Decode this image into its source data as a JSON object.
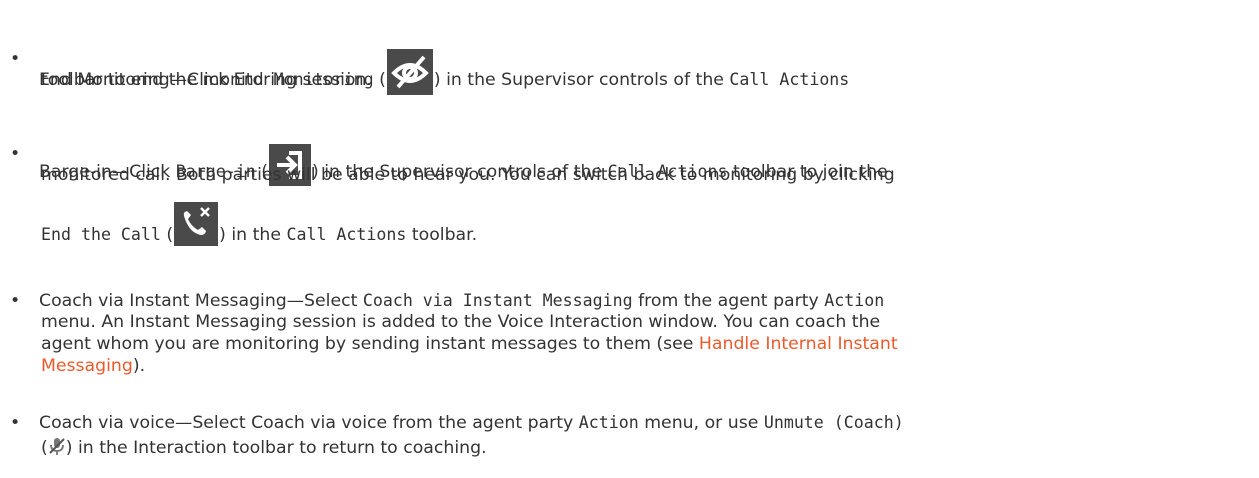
{
  "items": [
    {
      "label": "End Monitoring",
      "dash": "—Click ",
      "code1": "End Monitoring",
      "open": " (",
      "close": ") in the Supervisor controls of the ",
      "code2": "Call Actions",
      "line2": "toolbar to end the monitoring session.",
      "icon": "eye-slash-icon"
    },
    {
      "label": "Barge-in",
      "dash": "—Click ",
      "code1": "Barge-in",
      "open": " (",
      "close": ") in the Supervisor controls of the ",
      "code2": "Call Actions",
      "tail": " toolbar to join the",
      "line2": "monitored call. Both parties will be able to hear you. You can switch back to monitoring by clicking",
      "code3": "End the Call",
      "open2": " (",
      "close2": ") in the ",
      "code4": "Call Actions",
      "tail2": " toolbar.",
      "icon1": "enter-arrow-icon",
      "icon2": "end-call-icon"
    },
    {
      "label": "Coach via Instant Messaging",
      "dash": "—Select ",
      "code1": "Coach via Instant Messaging",
      "mid": " from the agent party ",
      "code2": "Action",
      "line2": "menu. An Instant Messaging session is added to the Voice Interaction window. You can coach the",
      "line3": "agent whom you are monitoring by sending instant messages to them (see ",
      "link1": "Handle Internal Instant",
      "link2": "Messaging",
      "line4tail": ")."
    },
    {
      "label": "Coach via voice",
      "dash": "—Select Coach via voice from the agent party ",
      "code1": "Action",
      "mid": " menu, or use ",
      "code2": "Unmute (Coach)",
      "open": "(",
      "close": ") in the Interaction toolbar to return to coaching.",
      "icon": "microphone-muted-icon"
    }
  ],
  "bullet": "•",
  "colors": {
    "text": "#333333",
    "link": "#ec5a2c",
    "iconBg": "#4a4a4a"
  }
}
